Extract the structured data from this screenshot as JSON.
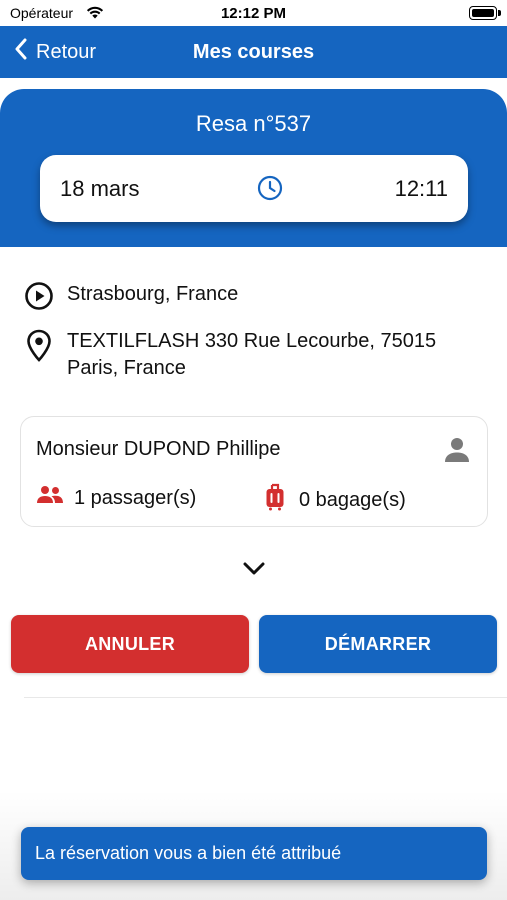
{
  "status_bar": {
    "carrier": "Opérateur",
    "time": "12:12 PM"
  },
  "nav": {
    "back_label": "Retour",
    "title": "Mes courses",
    "color": "#1565c0"
  },
  "booking": {
    "title": "Resa n°537",
    "date": "18 mars",
    "time": "12:11"
  },
  "addresses": {
    "start": "Strasbourg, France",
    "end": "TEXTILFLASH 330 Rue Lecourbe, 75015 Paris, France"
  },
  "passenger": {
    "name": "Monsieur DUPOND Phillipe",
    "passengers": "1 passager(s)",
    "luggage": "0 bagage(s)"
  },
  "actions": {
    "cancel_label": "ANNULER",
    "start_label": "DÉMARRER",
    "cancel_color": "#d32f2f",
    "start_color": "#1565c0"
  },
  "toast": {
    "message": "La réservation vous a bien été attribué"
  },
  "icons": {
    "back": "chevron-left-icon",
    "clock": "clock-icon",
    "start": "play-circle-icon",
    "end": "location-pin-icon",
    "person": "person-icon",
    "passengers": "group-icon",
    "luggage": "luggage-icon",
    "expand": "chevron-down-icon"
  }
}
